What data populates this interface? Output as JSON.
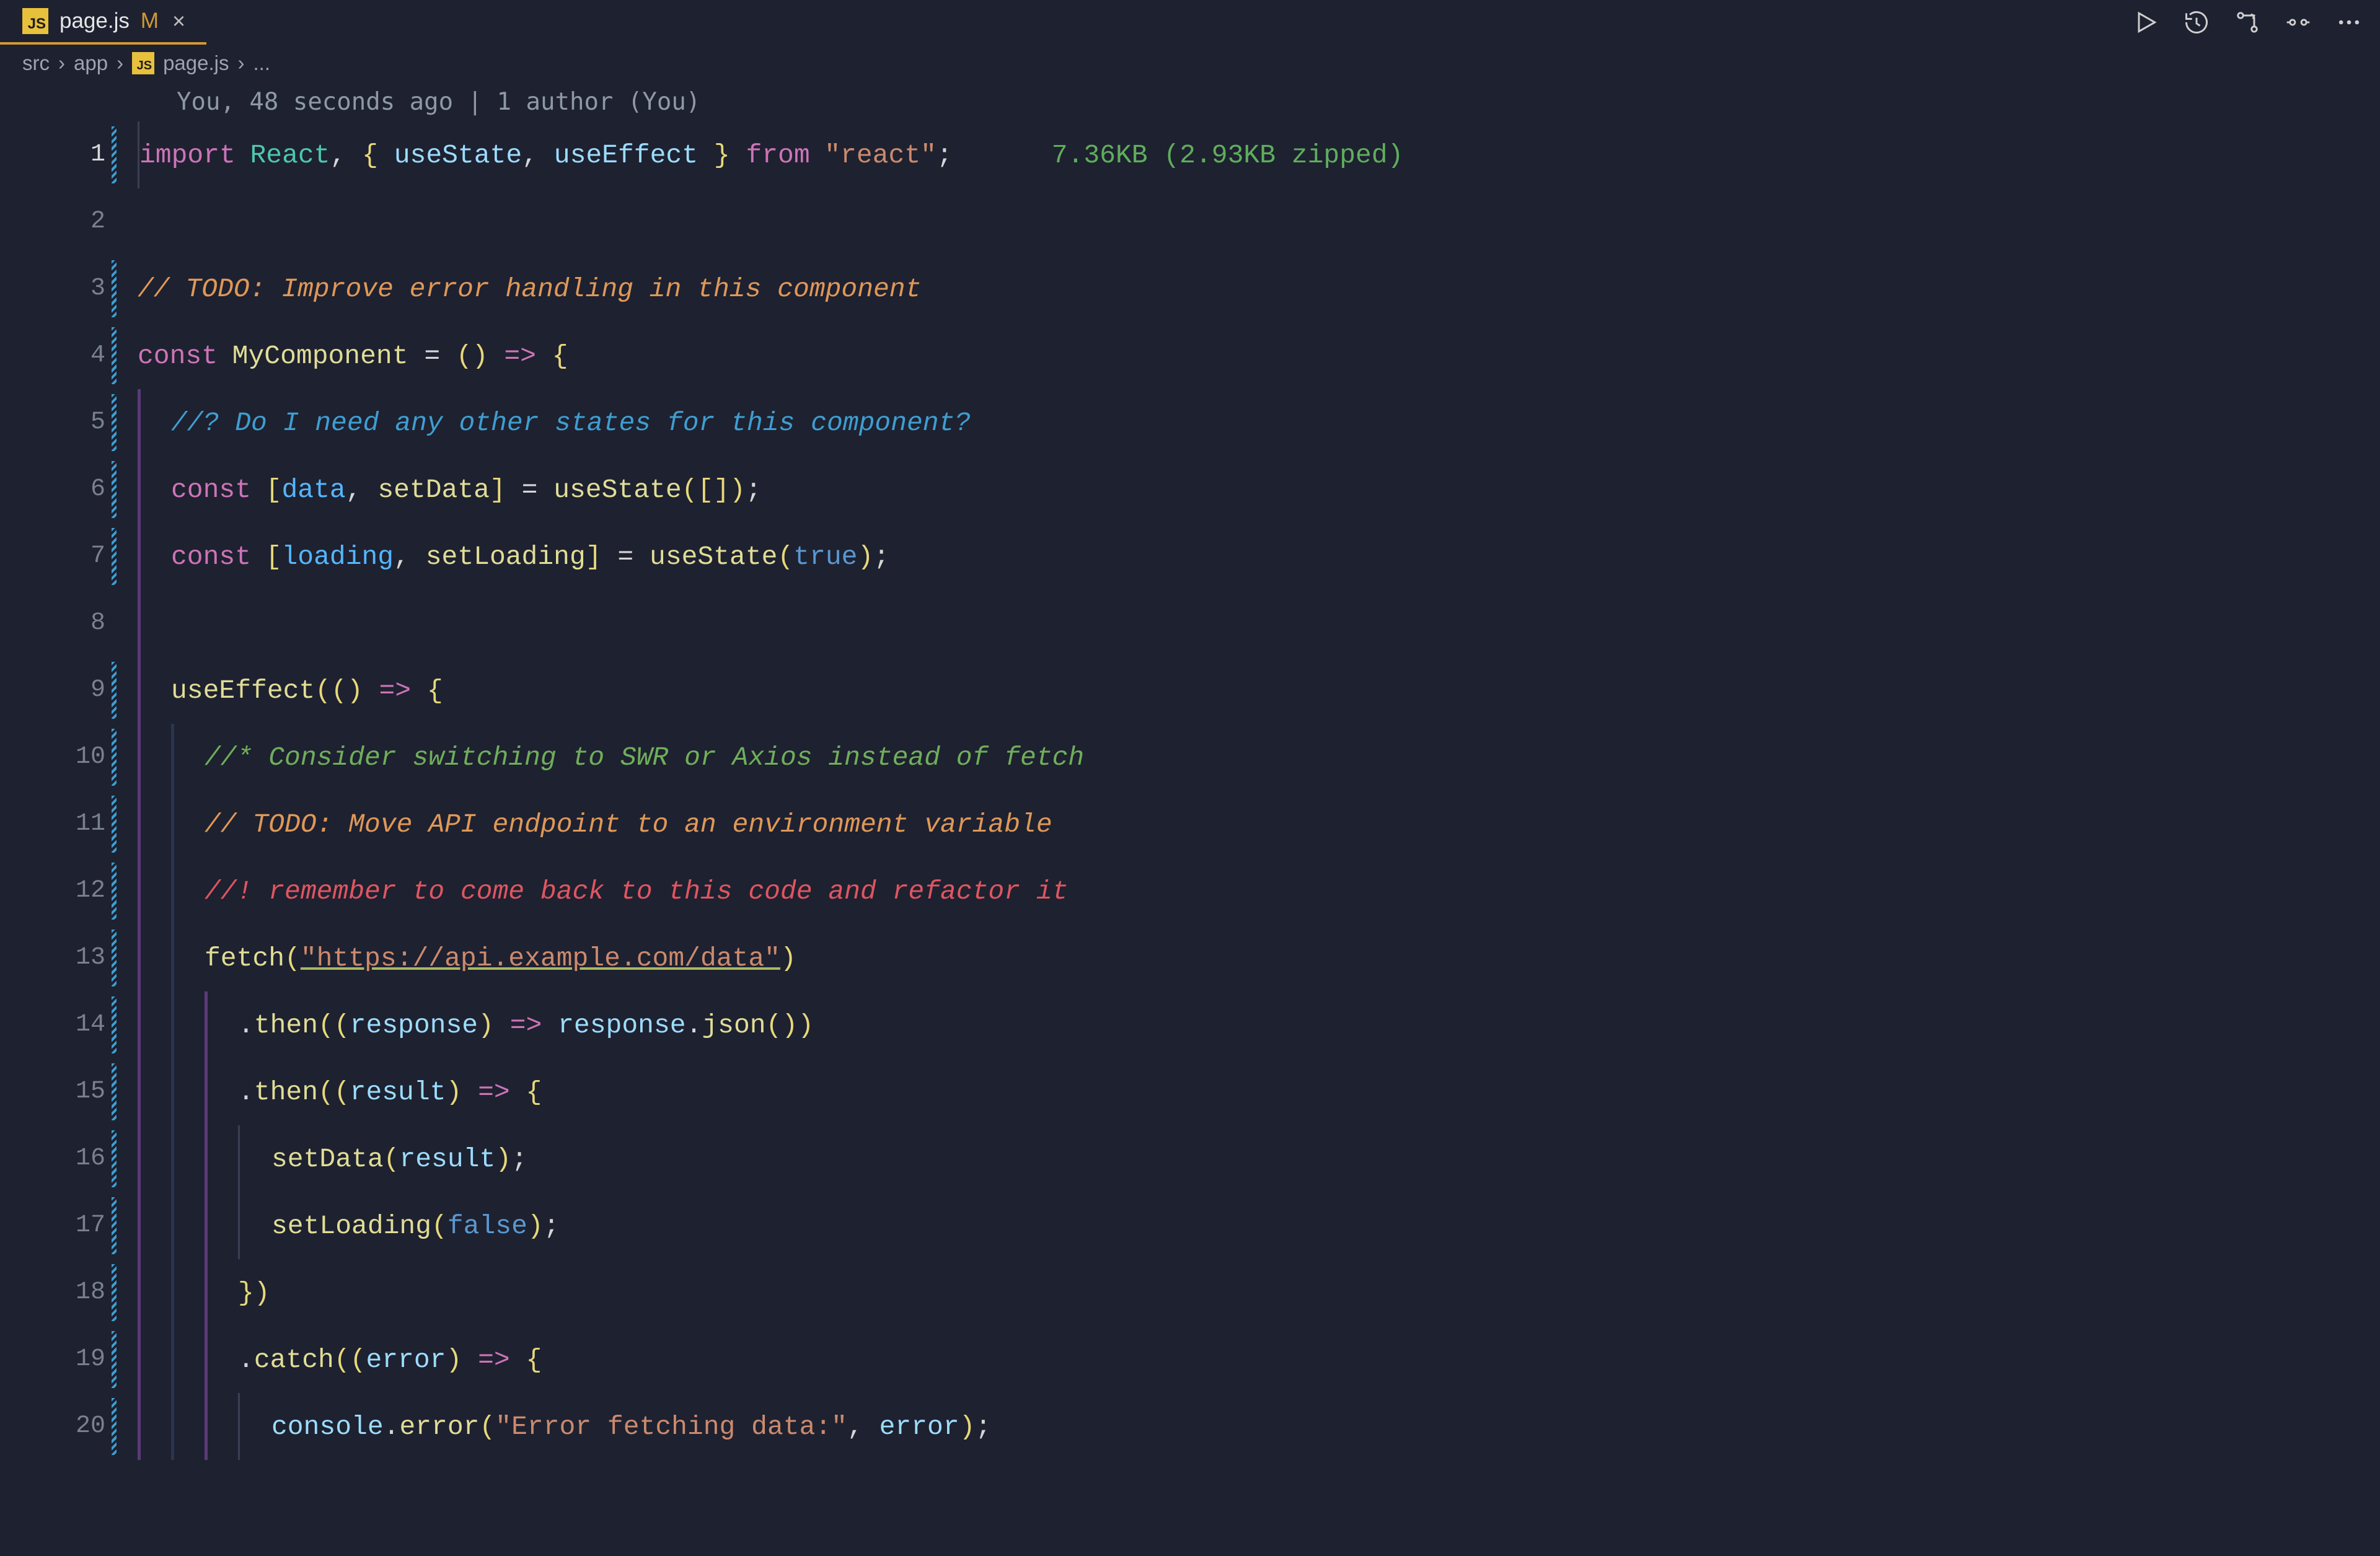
{
  "tab": {
    "icon_text": "JS",
    "filename": "page.js",
    "modified_marker": "M",
    "close_glyph": "×"
  },
  "breadcrumb": {
    "seg1": "src",
    "seg2": "app",
    "icon_text": "JS",
    "seg3": "page.js",
    "ellipsis": "...",
    "sep": "›"
  },
  "codelens": "You, 48 seconds ago | 1 author (You)",
  "size_hint": "7.36KB (2.93KB zipped)",
  "kw": {
    "import": "import",
    "from": "from",
    "const": "const",
    "true": "true",
    "false": "false"
  },
  "id": {
    "React": "React",
    "useState": "useState",
    "useEffect": "useEffect",
    "MyComponent": "MyComponent",
    "data": "data",
    "setData": "setData",
    "loading": "loading",
    "setLoading": "setLoading",
    "fetch": "fetch",
    "then": "then",
    "response": "response",
    "json": "json",
    "result": "result",
    "catch": "catch",
    "error": "error",
    "console": "console",
    "errorfn": "error"
  },
  "str": {
    "react": "\"react\"",
    "url": "\"https://api.example.com/data\"",
    "errmsg": "\"Error fetching data:\""
  },
  "cmt": {
    "l3": "// TODO: Improve error handling in this component",
    "l5": "//? Do I need any other states for this component?",
    "l10": "//* Consider switching to SWR or Axios instead of fetch",
    "l11": "// TODO: Move API endpoint to an environment variable",
    "l12": "//! remember to come back to this code and refactor it"
  },
  "ln": {
    "n1": "1",
    "n2": "2",
    "n3": "3",
    "n4": "4",
    "n5": "5",
    "n6": "6",
    "n7": "7",
    "n8": "8",
    "n9": "9",
    "n10": "10",
    "n11": "11",
    "n12": "12",
    "n13": "13",
    "n14": "14",
    "n15": "15",
    "n16": "16",
    "n17": "17",
    "n18": "18",
    "n19": "19",
    "n20": "20"
  }
}
